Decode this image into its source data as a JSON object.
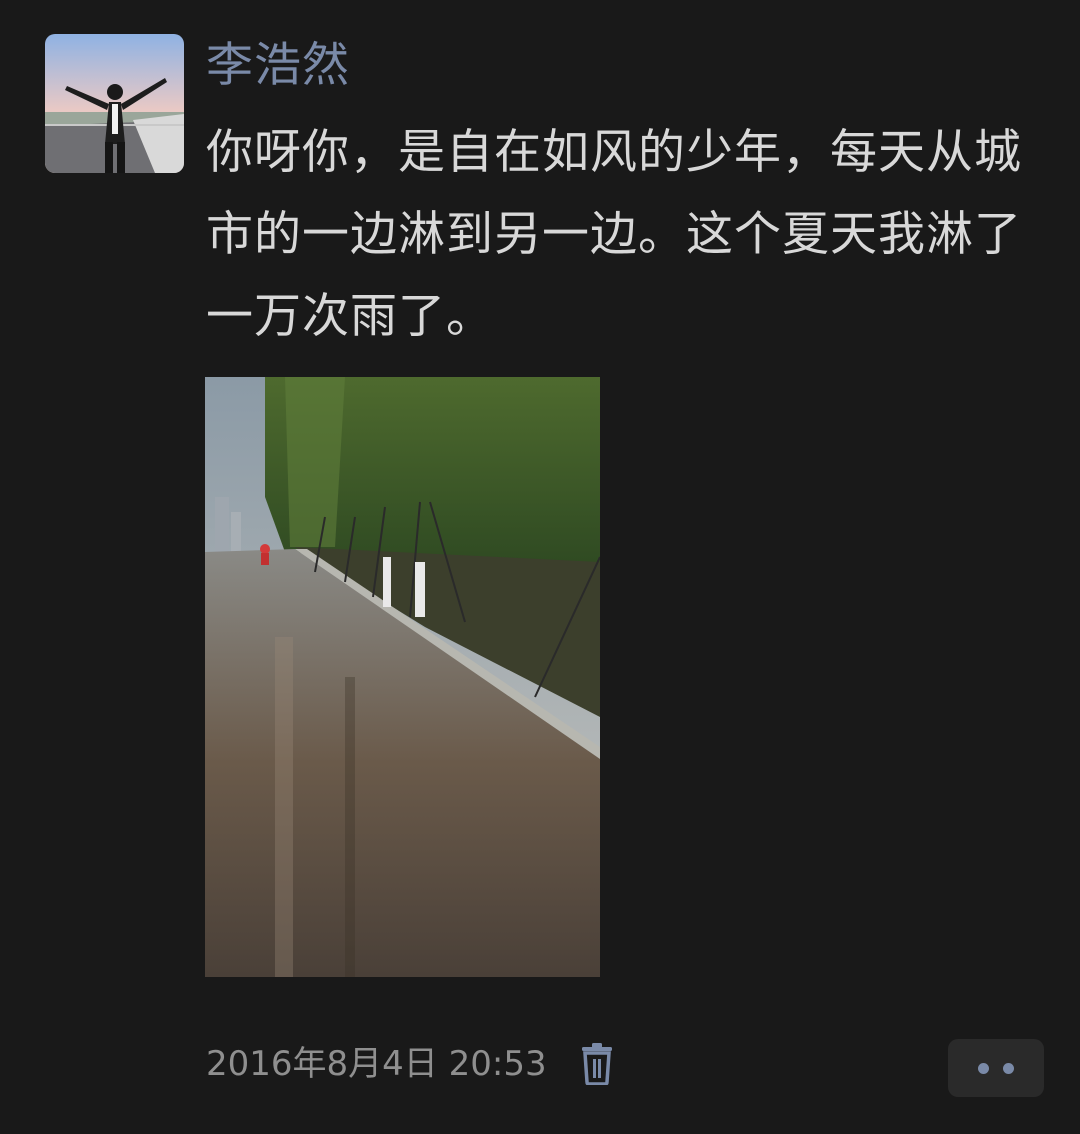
{
  "post": {
    "author": "李浩然",
    "text": "你呀你，是自在如风的少年，每天从城市的一边淋到另一边。这个夏天我淋了一万次雨了。",
    "timestamp": "2016年8月4日 20:53"
  },
  "icons": {
    "delete": "trash-icon",
    "more": "more-dots-icon"
  },
  "colors": {
    "background": "#191919",
    "author": "#7a8aa8",
    "text": "#d8d8d8",
    "timestamp": "#8f8f8f",
    "accent": "#7a8aa8"
  }
}
